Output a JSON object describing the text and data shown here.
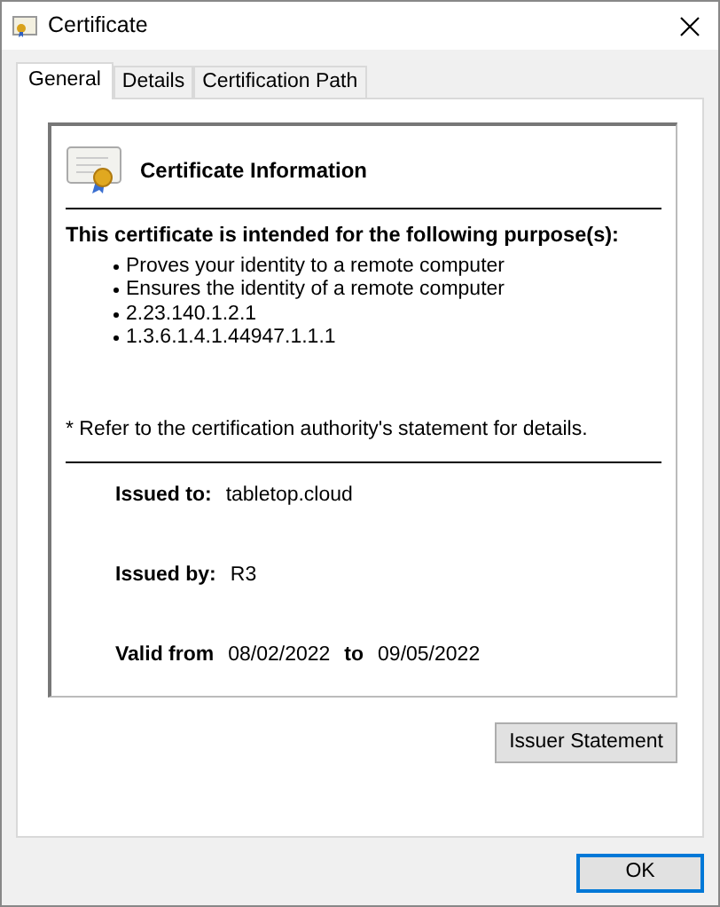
{
  "window": {
    "title": "Certificate"
  },
  "tabs": [
    {
      "label": "General",
      "selected": true
    },
    {
      "label": "Details",
      "selected": false
    },
    {
      "label": "Certification Path",
      "selected": false
    }
  ],
  "info": {
    "heading": "Certificate Information",
    "purpose_title": "This certificate is intended for the following purpose(s):",
    "purposes": [
      "Proves your identity to a remote computer",
      "Ensures the identity of a remote computer",
      "2.23.140.1.2.1",
      "1.3.6.1.4.1.44947.1.1.1"
    ],
    "note": "* Refer to the certification authority's statement for details.",
    "issued_to": {
      "label": "Issued to:",
      "value": "tabletop.cloud"
    },
    "issued_by": {
      "label": "Issued by:",
      "value": "R3"
    },
    "valid": {
      "label": "Valid from",
      "from": "08/02/2022",
      "to_label": "to",
      "to": "09/05/2022"
    }
  },
  "buttons": {
    "issuer_statement": "Issuer Statement",
    "ok": "OK"
  }
}
